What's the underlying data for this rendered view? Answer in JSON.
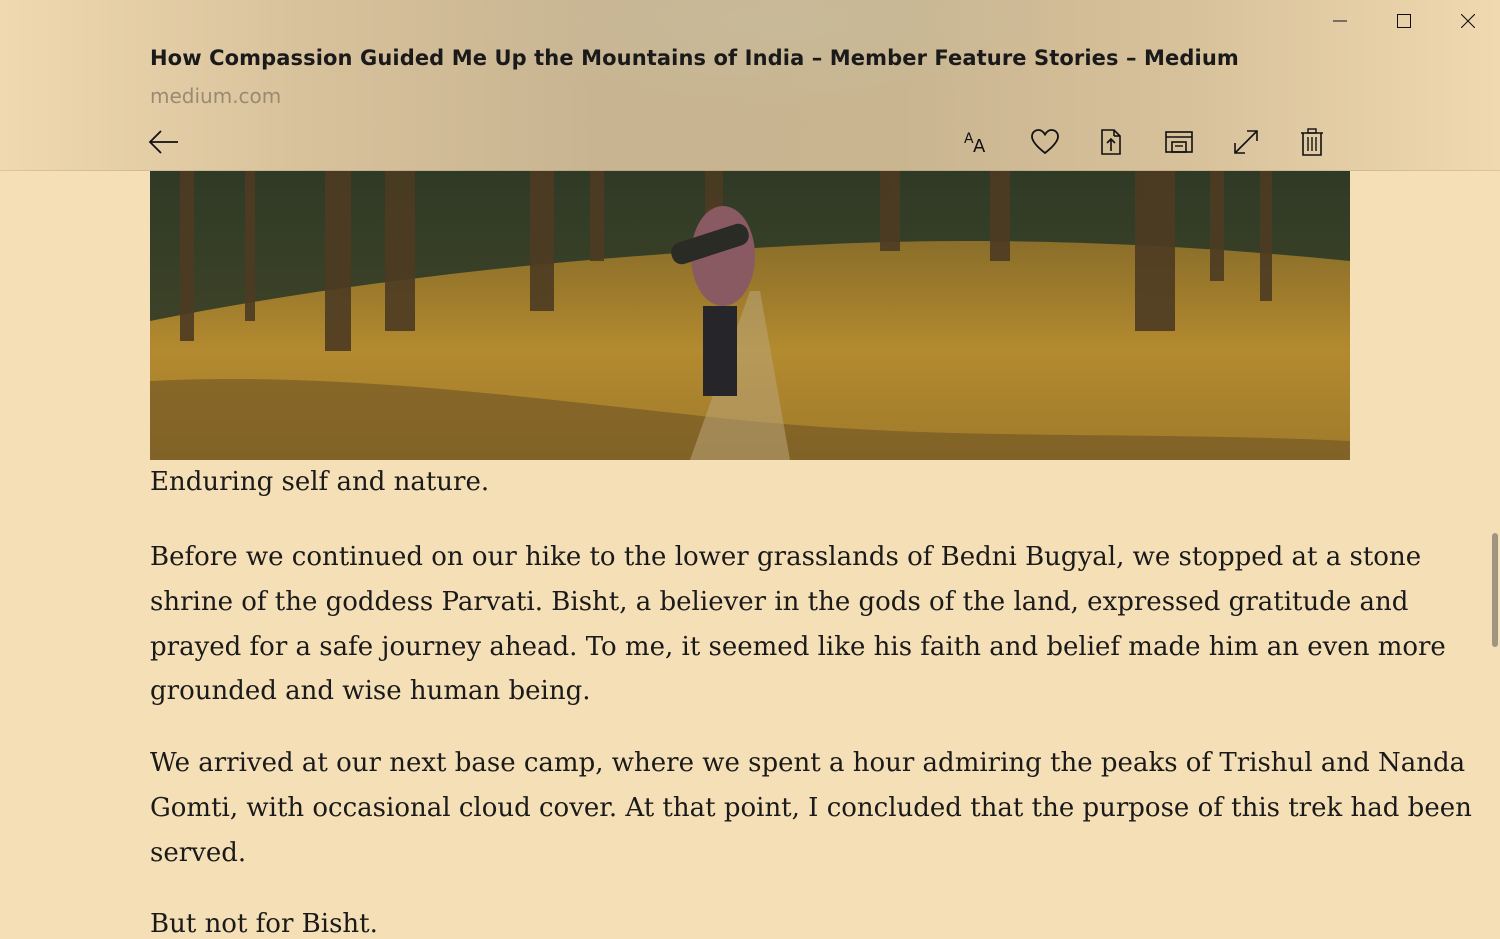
{
  "window": {
    "controls": {
      "minimize": "minimize",
      "maximize": "maximize",
      "close": "close"
    }
  },
  "header": {
    "title": "How Compassion Guided Me Up the Mountains of India – Member Feature Stories – Medium",
    "source": "medium.com"
  },
  "toolbar": {
    "icons": [
      "text-size-icon",
      "heart-icon",
      "share-icon",
      "save-offline-icon",
      "fullscreen-icon",
      "delete-icon"
    ]
  },
  "article": {
    "image_caption": "Enduring self and nature.",
    "paragraphs": [
      {
        "lines": [
          "Before we continued on our hike to the lower grasslands of Bedni Bugyal, we stopped at a stone",
          "shrine of the goddess Parvati. Bisht, a believer in the gods of the land, expressed gratitude and",
          "prayed for a safe journey ahead. To me, it seemed like his faith and belief made him an even more",
          "grounded and wise human being."
        ]
      },
      {
        "lines": [
          "We arrived at our next base camp, where we spent a hour admiring the peaks of Trishul and Nanda",
          "Gomti, with occasional cloud cover. At that point, I concluded that the purpose of this trek had been",
          "served."
        ]
      },
      {
        "lines": [
          "But not for Bisht."
        ]
      }
    ]
  },
  "colors": {
    "background": "#f5dfb6",
    "text": "#1a1a1a",
    "source_text": "#9a8a72"
  }
}
